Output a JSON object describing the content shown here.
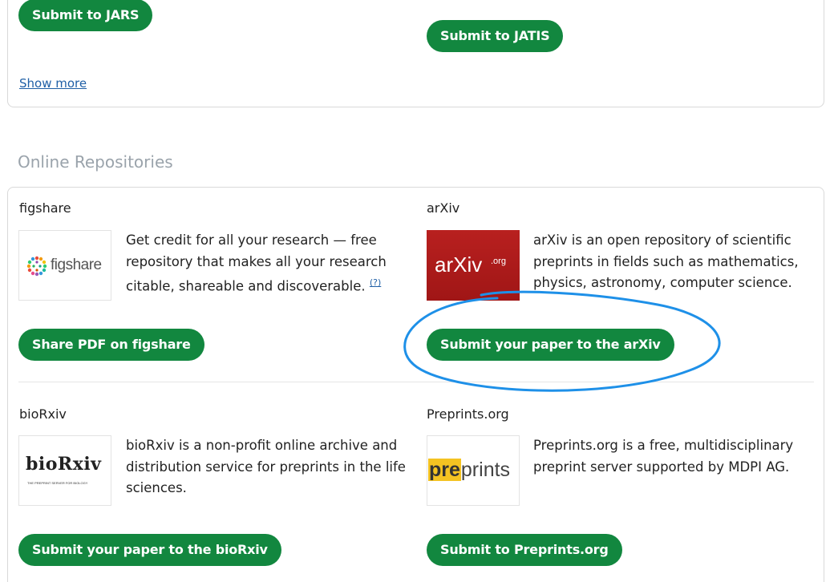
{
  "top_section": {
    "jars_button": "Submit to JARS",
    "jatis_button": "Submit to JATIS",
    "show_more": "Show more"
  },
  "repositories": {
    "title": "Online Repositories",
    "figshare": {
      "name": "figshare",
      "logo_text": "figshare",
      "description": "Get credit for all your research — free repository that makes all your research citable, shareable and discoverable.",
      "help": "(?)",
      "button": "Share PDF on figshare"
    },
    "arxiv": {
      "name": "arXiv",
      "logo_text": "arXiv",
      "logo_suffix": ".org",
      "description": "arXiv is an open repository of scientific preprints in fields such as mathematics, physics, astronomy, computer science.",
      "button": "Submit your paper to the arXiv"
    },
    "biorxiv": {
      "name": "bioRxiv",
      "logo_text": "bioRxiv",
      "logo_sub": "THE PREPRINT SERVER FOR BIOLOGY",
      "description": "bioRxiv is a non-profit online archive and distribution service for preprints in the life sciences.",
      "button": "Submit your paper to the bioRxiv"
    },
    "preprints": {
      "name": "Preprints.org",
      "logo_pre": "pre",
      "logo_rest": "prints",
      "description": "Preprints.org is a free, multidisciplinary preprint server supported by MDPI AG.",
      "button": "Submit to Preprints.org"
    }
  },
  "colors": {
    "button_green": "#12873f",
    "link_blue": "#1f5fa6",
    "arxiv_red": "#b31b1b",
    "annotation_blue": "#1e90e8"
  }
}
